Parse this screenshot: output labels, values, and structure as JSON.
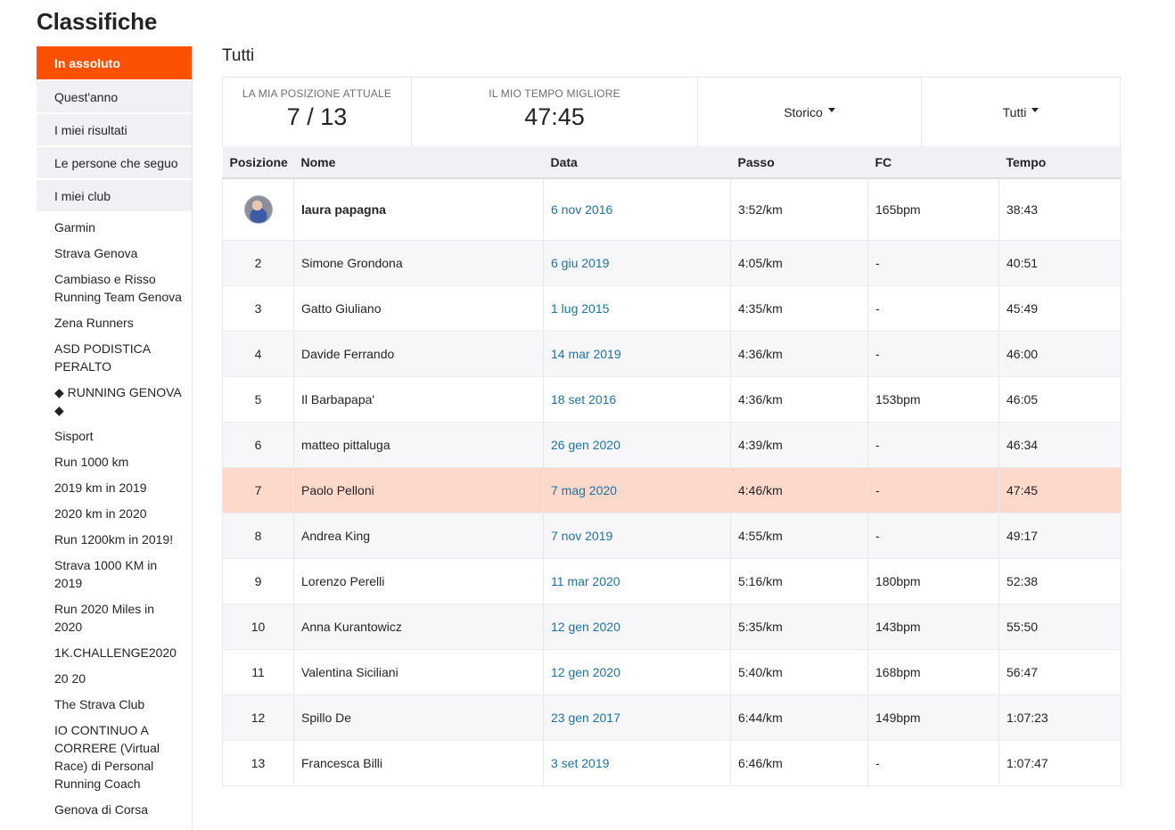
{
  "page_title": "Classifiche",
  "sidebar": {
    "tabs": [
      {
        "label": "In assoluto",
        "active": true
      },
      {
        "label": "Quest'anno",
        "active": false
      },
      {
        "label": "I miei risultati",
        "active": false
      },
      {
        "label": "Le persone che seguo",
        "active": false
      },
      {
        "label": "I miei club",
        "active": false
      }
    ],
    "clubs": [
      "Garmin",
      "Strava Genova",
      "Cambiaso e Risso Running Team Genova",
      "Zena Runners",
      "ASD PODISTICA PERALTO",
      "◆ RUNNING GENOVA ◆",
      "Sisport",
      "Run 1000 km",
      "2019 km in 2019",
      "2020 km in 2020",
      "Run 1200km in 2019!",
      "Strava 1000 KM in 2019",
      "Run 2020 Miles in 2020",
      "1K.CHALLENGE2020",
      "20 20",
      "The Strava Club",
      "IO CONTINUO A CORRERE (Virtual Race) di Personal Running Coach",
      "Genova di Corsa"
    ]
  },
  "main": {
    "section_title": "Tutti",
    "summary": {
      "position_label": "LA MIA POSIZIONE ATTUALE",
      "position_value": "7 / 13",
      "best_label": "IL MIO TEMPO MIGLIORE",
      "best_value": "47:45",
      "history_dropdown": "Storico",
      "filter_dropdown": "Tutti"
    },
    "table": {
      "headers": {
        "pos": "Posizione",
        "name": "Nome",
        "date": "Data",
        "pace": "Passo",
        "hr": "FC",
        "time": "Tempo"
      },
      "rows": [
        {
          "pos": "",
          "avatar": true,
          "name": "laura papagna",
          "date": "6 nov 2016",
          "pace": "3:52/km",
          "hr": "165bpm",
          "time": "38:43"
        },
        {
          "pos": "2",
          "name": "Simone Grondona",
          "date": "6 giu 2019",
          "pace": "4:05/km",
          "hr": "-",
          "time": "40:51"
        },
        {
          "pos": "3",
          "name": "Gatto Giuliano",
          "date": "1 lug 2015",
          "pace": "4:35/km",
          "hr": "-",
          "time": "45:49"
        },
        {
          "pos": "4",
          "name": "Davide Ferrando",
          "date": "14 mar 2019",
          "pace": "4:36/km",
          "hr": "-",
          "time": "46:00"
        },
        {
          "pos": "5",
          "name": "Il Barbapapa'",
          "date": "18 set 2016",
          "pace": "4:36/km",
          "hr": "153bpm",
          "time": "46:05"
        },
        {
          "pos": "6",
          "name": "matteo pittaluga",
          "date": "26 gen 2020",
          "pace": "4:39/km",
          "hr": "-",
          "time": "46:34"
        },
        {
          "pos": "7",
          "name": "Paolo Pelloni",
          "date": "7 mag 2020",
          "pace": "4:46/km",
          "hr": "-",
          "time": "47:45",
          "highlight": true
        },
        {
          "pos": "8",
          "name": "Andrea King",
          "date": "7 nov 2019",
          "pace": "4:55/km",
          "hr": "-",
          "time": "49:17"
        },
        {
          "pos": "9",
          "name": "Lorenzo Perelli",
          "date": "11 mar 2020",
          "pace": "5:16/km",
          "hr": "180bpm",
          "time": "52:38"
        },
        {
          "pos": "10",
          "name": "Anna Kurantowicz",
          "date": "12 gen 2020",
          "pace": "5:35/km",
          "hr": "143bpm",
          "time": "55:50"
        },
        {
          "pos": "11",
          "name": "Valentina Siciliani",
          "date": "12 gen 2020",
          "pace": "5:40/km",
          "hr": "168bpm",
          "time": "56:47"
        },
        {
          "pos": "12",
          "name": "Spillo De",
          "date": "23 gen 2017",
          "pace": "6:44/km",
          "hr": "149bpm",
          "time": "1:07:23"
        },
        {
          "pos": "13",
          "name": "Francesca Billi",
          "date": "3 set 2019",
          "pace": "6:46/km",
          "hr": "-",
          "time": "1:07:47"
        }
      ]
    }
  },
  "colors": {
    "accent": "#fc5200",
    "link": "#1a73a6",
    "highlight_row": "#fdd9cb"
  }
}
